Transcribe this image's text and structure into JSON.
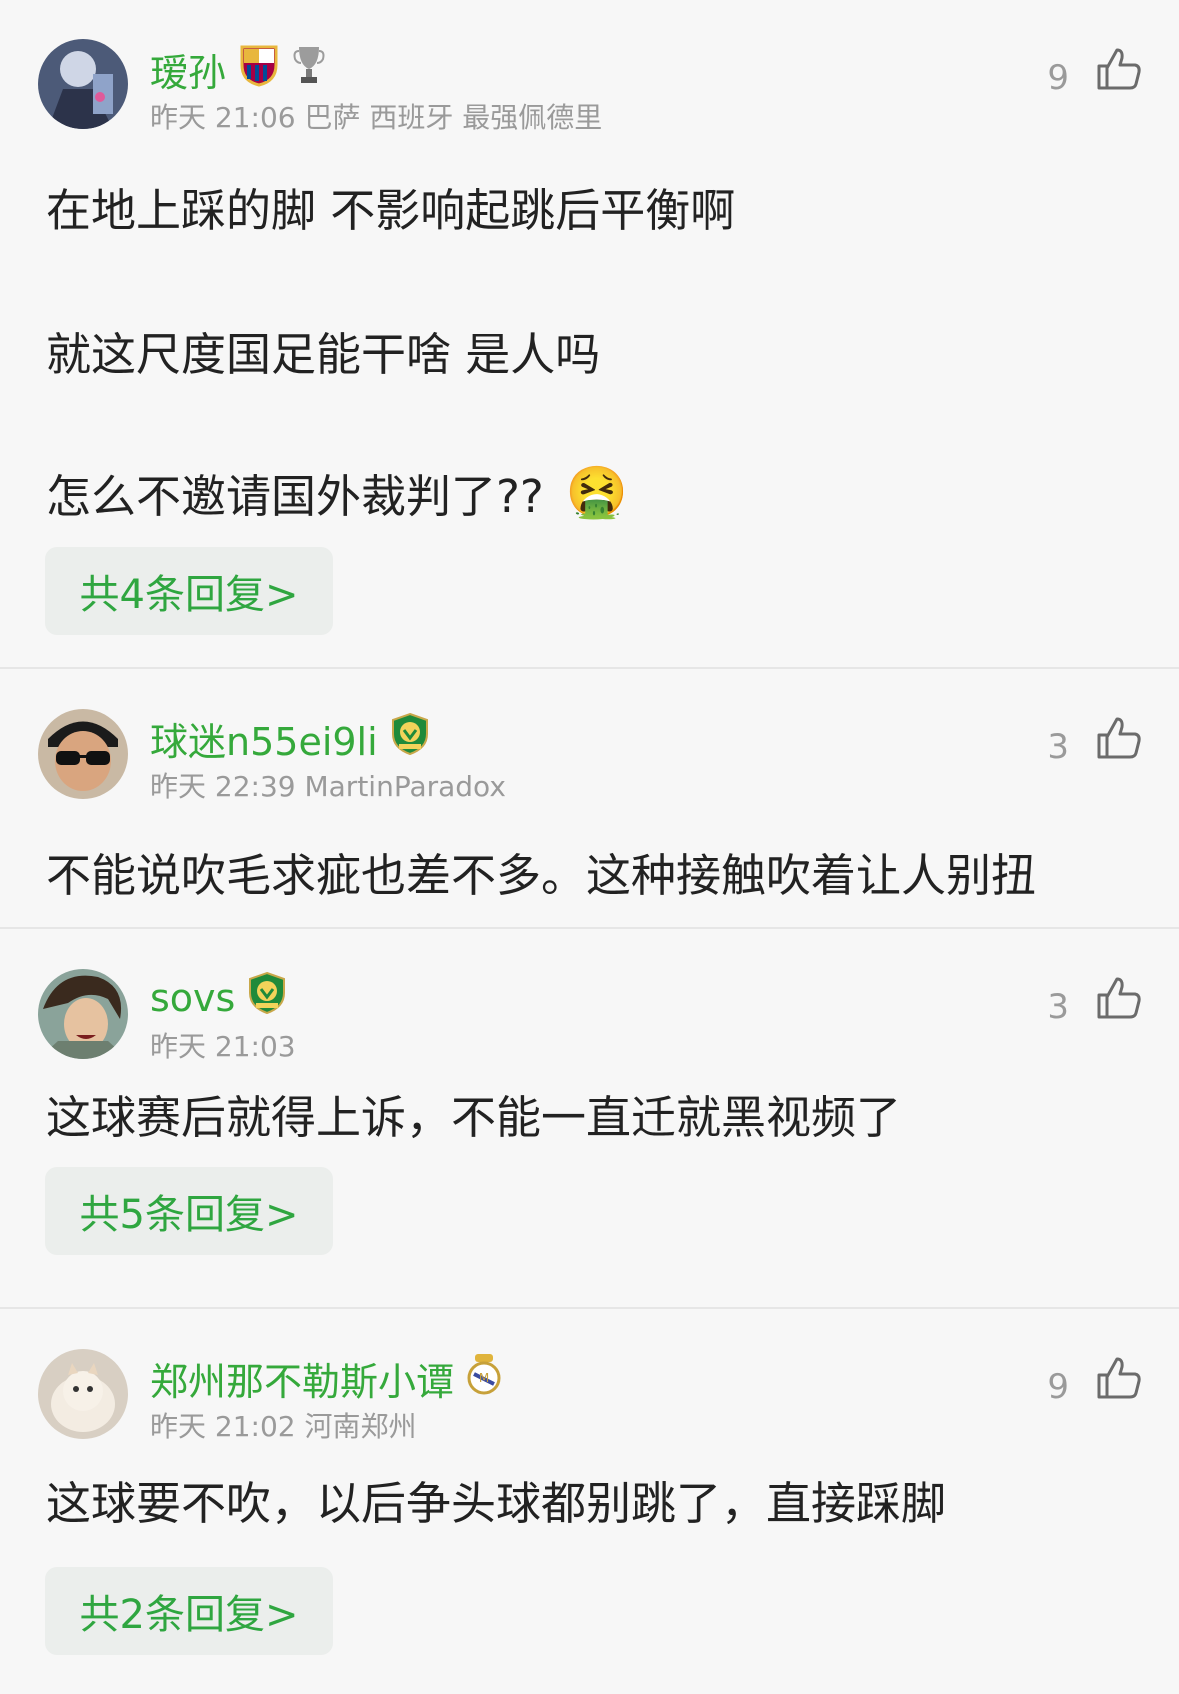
{
  "comments": [
    {
      "username": "瑷孙",
      "meta": "昨天 21:06 巴萨 西班牙 最强佩德里",
      "likes": "9",
      "lines": [
        "在地上踩的脚 不影响起跳后平衡啊",
        "就这尺度国足能干啥 是人吗",
        "怎么不邀请国外裁判了??"
      ],
      "emoji": "🤮",
      "reply": "共4条回复>",
      "badges": [
        "barcelona-crest-icon",
        "trophy-icon"
      ]
    },
    {
      "username": "球迷n55ei9li",
      "meta": "昨天 22:39 MartinParadox",
      "likes": "3",
      "lines": [
        "不能说吹毛求疵也差不多。这种接触吹着让人别扭"
      ],
      "badges": [
        "beijing-guoan-crest-icon"
      ]
    },
    {
      "username": "sovs",
      "meta": "昨天 21:03",
      "likes": "3",
      "lines": [
        "这球赛后就得上诉，不能一直迁就黑视频了"
      ],
      "reply": "共5条回复>",
      "badges": [
        "beijing-guoan-crest-icon"
      ]
    },
    {
      "username": "郑州那不勒斯小谭",
      "meta": "昨天 21:02 河南郑州",
      "likes": "9",
      "lines": [
        "这球要不吹，以后争头球都别跳了，直接踩脚"
      ],
      "reply": "共2条回复>",
      "badges": [
        "real-madrid-crest-icon"
      ]
    }
  ],
  "colors": {
    "username": "#35a93b",
    "reply_text": "#2fa640",
    "reply_bg": "#ebeeec",
    "meta": "#9a9a9a",
    "background": "#f7f7f7"
  }
}
